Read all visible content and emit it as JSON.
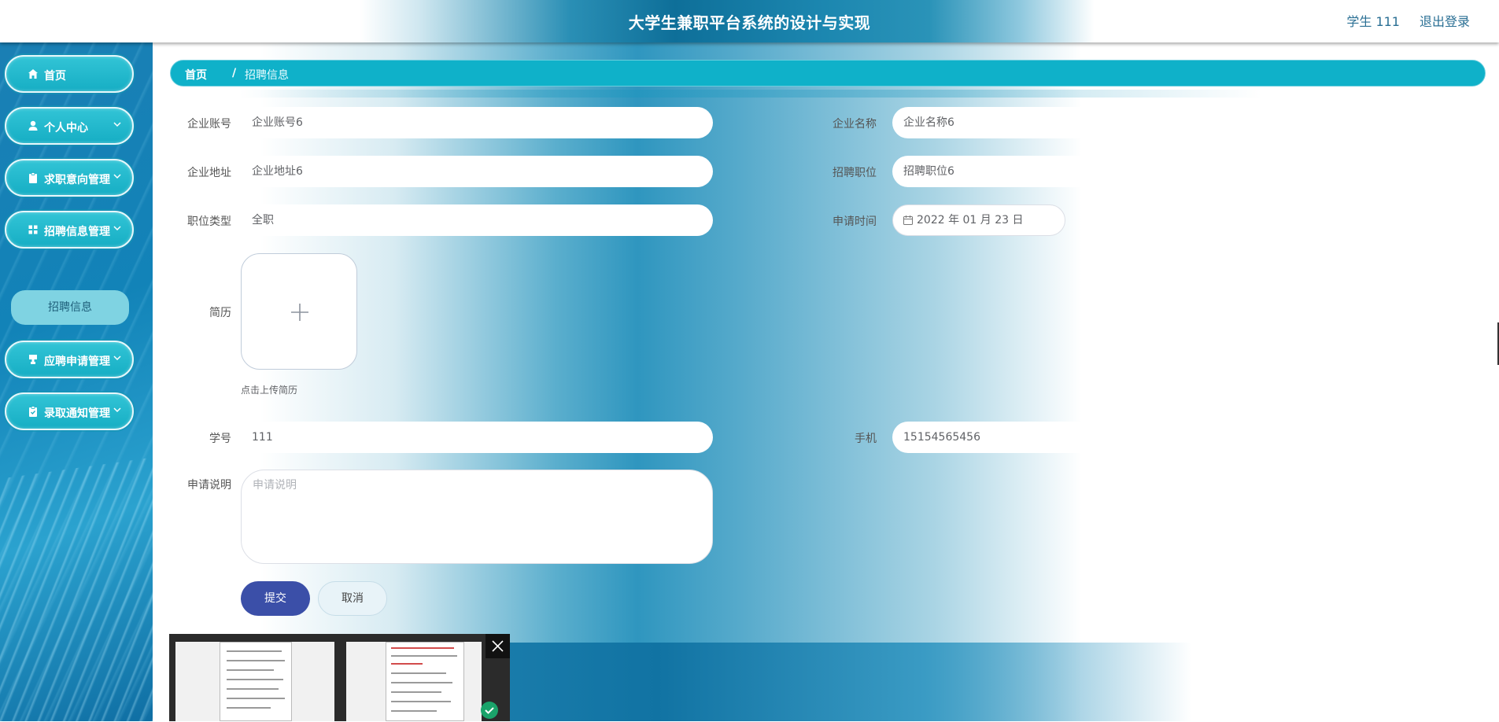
{
  "header": {
    "title": "大学生兼职平台系统的设计与实现",
    "user": "学生 111",
    "logout": "退出登录"
  },
  "sidebar": {
    "items": [
      {
        "label": "首页",
        "icon": "home-icon"
      },
      {
        "label": "个人中心",
        "icon": "user-icon"
      },
      {
        "label": "求职意向管理",
        "icon": "clipboard-icon"
      },
      {
        "label": "招聘信息管理",
        "icon": "grid-icon"
      },
      {
        "label": "应聘申请管理",
        "icon": "stamp-icon"
      },
      {
        "label": "录取通知管理",
        "icon": "clipboard-check-icon"
      }
    ],
    "sub_item": "招聘信息"
  },
  "breadcrumb": {
    "home": "首页",
    "separator": "/",
    "current": "招聘信息"
  },
  "form": {
    "company_account": {
      "label": "企业账号",
      "value": "企业账号6"
    },
    "company_name": {
      "label": "企业名称",
      "value": "企业名称6"
    },
    "company_address": {
      "label": "企业地址",
      "value": "企业地址6"
    },
    "position": {
      "label": "招聘职位",
      "value": "招聘职位6"
    },
    "job_type": {
      "label": "职位类型",
      "value": "全职"
    },
    "apply_time": {
      "label": "申请时间",
      "value": "2022 年 01 月 23 日"
    },
    "resume": {
      "label": "简历",
      "tip": "点击上传简历"
    },
    "student_id": {
      "label": "学号",
      "value": "111"
    },
    "phone": {
      "label": "手机",
      "value": "15154565456"
    },
    "description": {
      "label": "申请说明",
      "placeholder": "申请说明"
    },
    "submit": "提交",
    "cancel": "取消"
  },
  "colors": {
    "accent": "#0fb1c9",
    "submit": "#3b4fa8"
  }
}
